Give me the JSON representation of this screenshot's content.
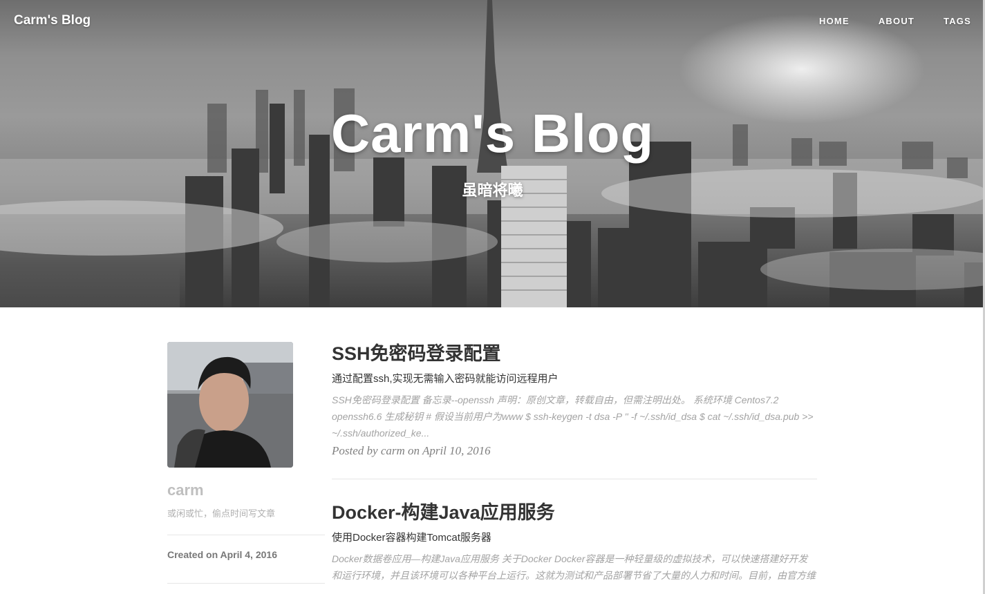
{
  "nav": {
    "brand": "Carm's Blog",
    "links": [
      {
        "label": "HOME"
      },
      {
        "label": "ABOUT"
      },
      {
        "label": "TAGS"
      }
    ]
  },
  "hero": {
    "title": "Carm's Blog",
    "subtitle": "虽暗将曦"
  },
  "sidebar": {
    "avatar_icon": "author-avatar-photo",
    "author": "carm",
    "bio": "或闲或忙，偷点时间写文章",
    "created": "Created on April 4, 2016"
  },
  "posts": [
    {
      "title": "SSH免密码登录配置",
      "subtitle": "通过配置ssh,实现无需输入密码就能访问远程用户",
      "excerpt": "SSH免密码登录配置 备忘录--openssh 声明：原创文章，转载自由，但需注明出处。 系统环境 Centos7.2 openssh6.6 生成秘钥 # 假设当前用户为www $ ssh-keygen -t dsa -P '' -f ~/.ssh/id_dsa $ cat ~/.ssh/id_dsa.pub >> ~/.ssh/authorized_ke...",
      "meta": "Posted by carm on April 10, 2016"
    },
    {
      "title": "Docker-构建Java应用服务",
      "subtitle": "使用Docker容器构建Tomcat服务器",
      "excerpt": "Docker数据卷应用—构建Java应用服务 关于Docker Docker容器是一种轻量级的虚拟技术，可以快速搭建好开发和运行环境，并且该环境可以各种平台上运行。这就为测试和产品部署节省了大量的人力和时间。目前，由官方维"
    }
  ]
}
